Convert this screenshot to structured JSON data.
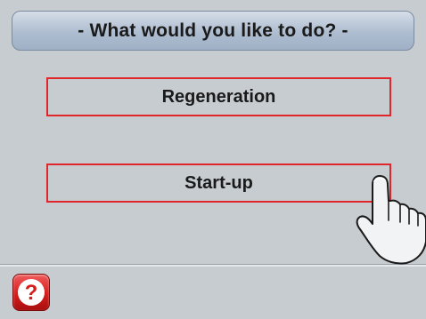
{
  "header": {
    "title": "- What would you like to do? -"
  },
  "actions": [
    {
      "label": "Regeneration"
    },
    {
      "label": "Start-up"
    }
  ],
  "footer": {
    "help_icon": "question-mark-icon",
    "help_glyph": "?"
  },
  "pointer": {
    "icon": "pointing-hand-icon"
  },
  "colors": {
    "background": "#c7ccd1",
    "button_border": "#e0262b",
    "header_gradient_top": "#d5dde8",
    "header_gradient_bottom": "#9fb0c6",
    "help_red": "#d61d1d"
  }
}
